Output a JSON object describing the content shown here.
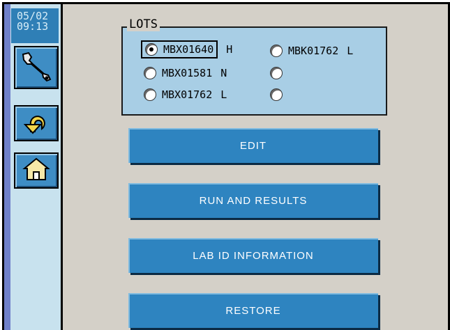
{
  "clock": {
    "date": "05/02",
    "time": "09:13"
  },
  "sidebar": {
    "buttons": [
      {
        "icon": "wrench-icon"
      },
      {
        "icon": "undo-arrow-icon"
      },
      {
        "icon": "home-icon"
      }
    ]
  },
  "lots": {
    "title": "LOTS",
    "selected": "MBX01640",
    "left": [
      {
        "name": "MBX01640",
        "level": "H",
        "selected": true
      },
      {
        "name": "MBX01581",
        "level": "N",
        "selected": false
      },
      {
        "name": "MBX01762",
        "level": "L",
        "selected": false
      }
    ],
    "right": [
      {
        "name": "MBK01762",
        "level": "L",
        "selected": false
      },
      {
        "name": "",
        "level": "",
        "selected": false
      },
      {
        "name": "",
        "level": "",
        "selected": false
      }
    ]
  },
  "actions": {
    "edit": "EDIT",
    "run_results": "RUN AND RESULTS",
    "lab_id": "LAB ID INFORMATION",
    "restore": "RESTORE"
  },
  "colors": {
    "panel": "#a8cee5",
    "button": "#2e84c0",
    "sidebar": "#c8e2ee",
    "stripe": "#6f80c9",
    "background": "#d4d0c8"
  }
}
